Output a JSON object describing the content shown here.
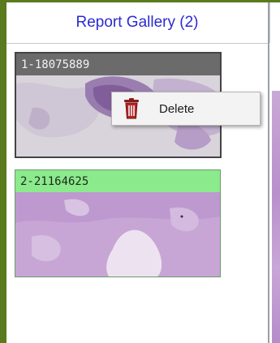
{
  "gallery": {
    "title": "Report Gallery (2)",
    "items": [
      {
        "label": "1-18075889",
        "state": "selected"
      },
      {
        "label": "2-21164625",
        "state": "highlighted"
      }
    ]
  },
  "context_menu": {
    "items": [
      {
        "label": "Delete",
        "icon": "trash-icon"
      }
    ]
  },
  "colors": {
    "frame": "#5a7a1e",
    "header_text": "#2b2bd0",
    "selected_title_bar": "#6b6b6b",
    "highlight_title_bar": "#8bea8b",
    "tissue": "#c7a6d6"
  }
}
